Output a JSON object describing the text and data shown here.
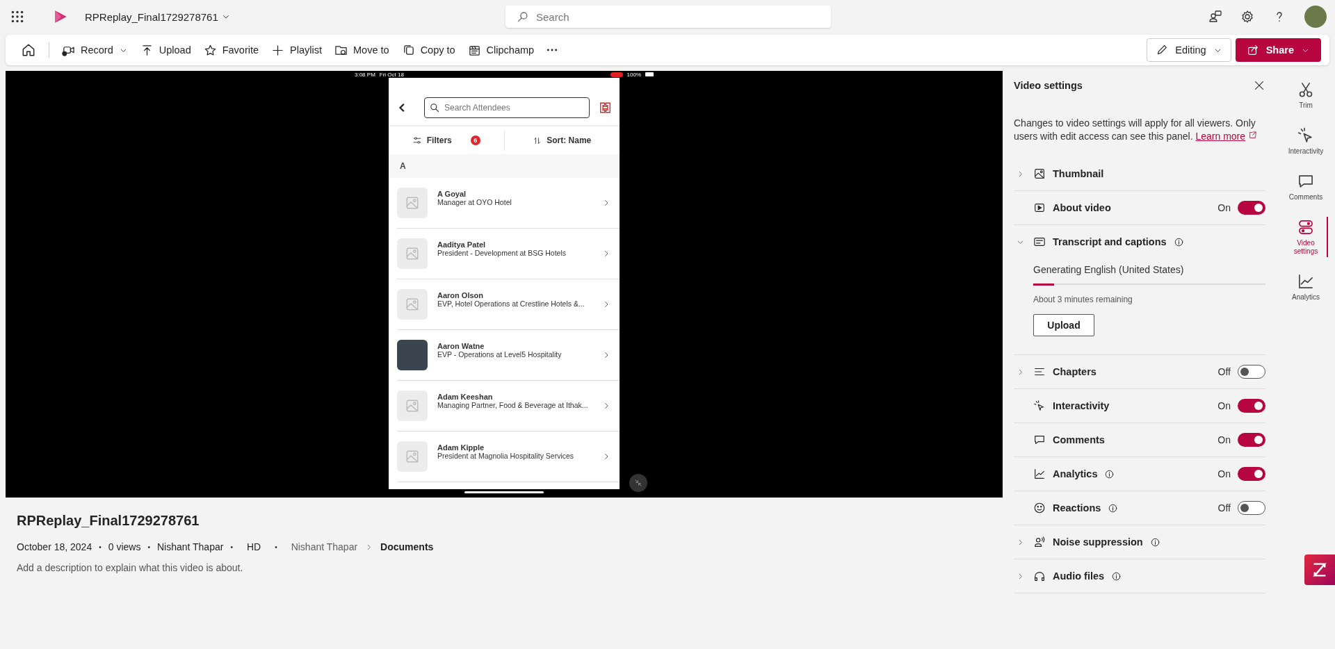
{
  "top_bar": {
    "file_title": "RPReplay_Final1729278761",
    "search_placeholder": "Search"
  },
  "toolbar": {
    "items": [
      {
        "label": "Record",
        "menu": true
      },
      {
        "label": "Upload",
        "menu": false
      },
      {
        "label": "Favorite",
        "menu": false
      },
      {
        "label": "Playlist",
        "menu": false
      },
      {
        "label": "Move to",
        "menu": false
      },
      {
        "label": "Copy to",
        "menu": false
      },
      {
        "label": "Clipchamp",
        "menu": false
      }
    ],
    "editing": "Editing",
    "share": "Share"
  },
  "video": {
    "status_bar": {
      "time": "3:08 PM",
      "date": "Fri Oct 18",
      "battery": "100%"
    },
    "app": {
      "search_placeholder": "Search Attendees",
      "filters": "Filters",
      "filter_count": "6",
      "sort": "Sort: Name",
      "section": "A",
      "attendees": [
        {
          "name": "A Goyal",
          "title": "Manager at OYO Hotel",
          "has_photo": false
        },
        {
          "name": "Aaditya Patel",
          "title": "President - Development at BSG Hotels",
          "has_photo": false
        },
        {
          "name": "Aaron Olson",
          "title": "EVP, Hotel Operations at Crestline Hotels &...",
          "has_photo": false
        },
        {
          "name": "Aaron Watne",
          "title": "EVP - Operations at Level5 Hospitality",
          "has_photo": true
        },
        {
          "name": "Adam Keeshan",
          "title": "Managing Partner, Food & Beverage at Ithak...",
          "has_photo": false
        },
        {
          "name": "Adam Kipple",
          "title": "President at Magnolia Hospitality Services",
          "has_photo": false
        }
      ]
    }
  },
  "details": {
    "title": "RPReplay_Final1729278761",
    "separator": "•",
    "meta": [
      "October 18, 2024",
      "0 views",
      "Nishant Thapar",
      "HD"
    ],
    "breadcrumb": [
      "Nishant Thapar",
      "Documents"
    ],
    "description": "Add a description to explain what this video is about."
  },
  "panel": {
    "title": "Video settings",
    "notice": "Changes to video settings will apply for all viewers. Only users with edit access can see this panel.",
    "link": "Learn more",
    "sections": [
      {
        "label": "Thumbnail",
        "info": false,
        "expanded": false
      },
      {
        "label": "About video",
        "info": false,
        "on": true,
        "state_label": "On"
      },
      {
        "label": "Transcript and captions",
        "info": true,
        "expanded": true,
        "status": "Generating English (United States)",
        "level": 0.09,
        "remaining": "About 3 minutes remaining",
        "button": "Upload"
      },
      {
        "label": "Chapters",
        "info": false,
        "expanded": false,
        "on": false,
        "state_label": "Off"
      },
      {
        "label": "Interactivity",
        "info": false,
        "on": true,
        "state_label": "On"
      },
      {
        "label": "Comments",
        "info": false,
        "on": true,
        "state_label": "On"
      },
      {
        "label": "Analytics",
        "info": true,
        "on": true,
        "state_label": "On"
      },
      {
        "label": "Reactions",
        "info": true,
        "on": false,
        "state_label": "Off"
      },
      {
        "label": "Noise suppression",
        "info": true,
        "expanded": false
      },
      {
        "label": "Audio files",
        "info": true,
        "expanded": false
      }
    ]
  },
  "rail": [
    {
      "label": "Trim",
      "selected": false
    },
    {
      "label": "Interactivity",
      "selected": false
    },
    {
      "label": "Comments",
      "selected": false
    },
    {
      "label": "Video settings",
      "selected": true
    },
    {
      "label": "Analytics",
      "selected": false
    }
  ]
}
